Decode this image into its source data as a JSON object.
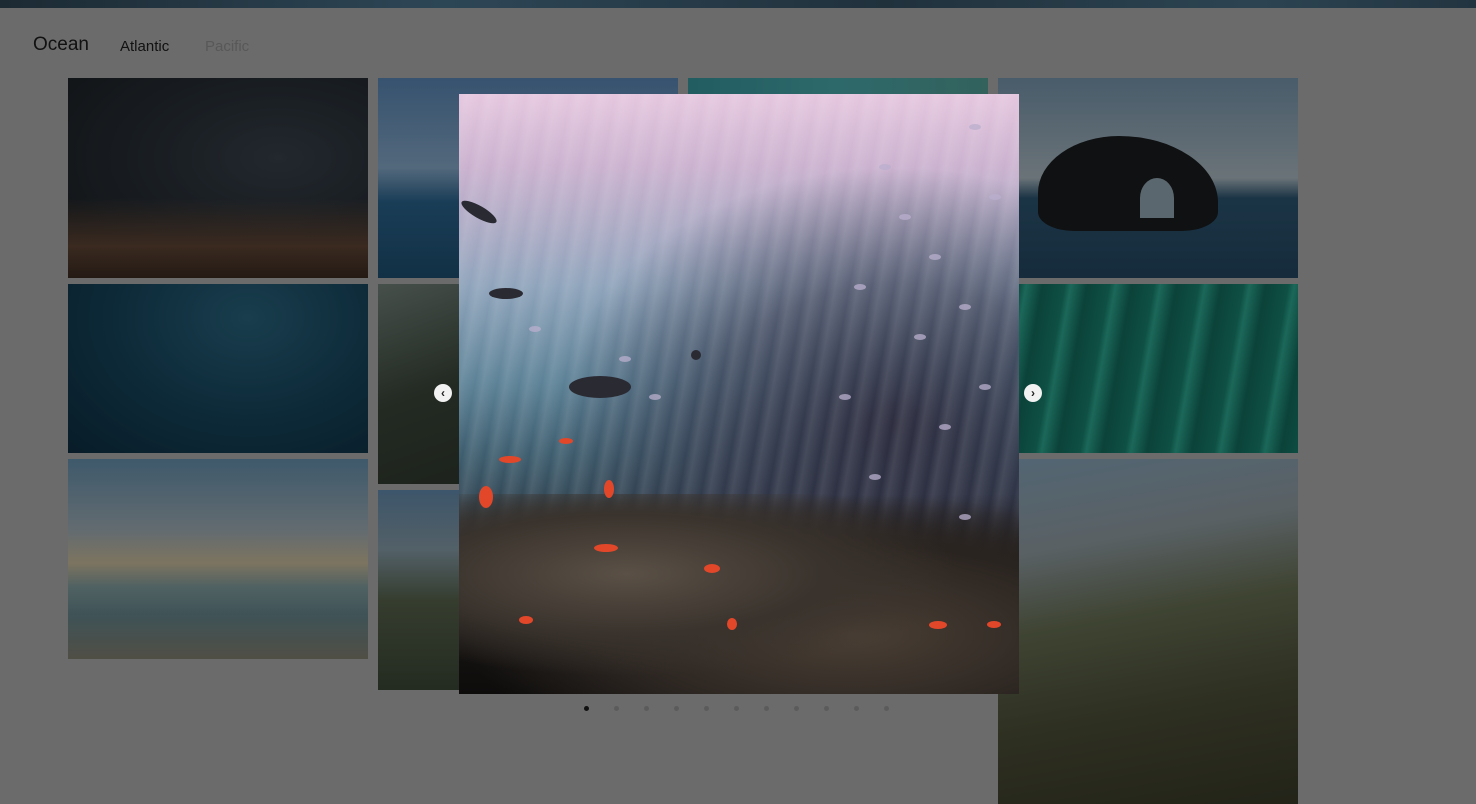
{
  "header": {
    "brand": "Ocean",
    "tabs": [
      {
        "label": "Atlantic",
        "active": true
      },
      {
        "label": "Pacific",
        "active": false
      }
    ]
  },
  "lightbox": {
    "prev_icon": "chevron-left-icon",
    "next_icon": "chevron-right-icon",
    "slide_count": 11,
    "active_slide": 1
  },
  "colors": {
    "backdrop": "#6b6b6b",
    "active_dot": "#111111",
    "inactive_dot": "#5b5b5b"
  }
}
